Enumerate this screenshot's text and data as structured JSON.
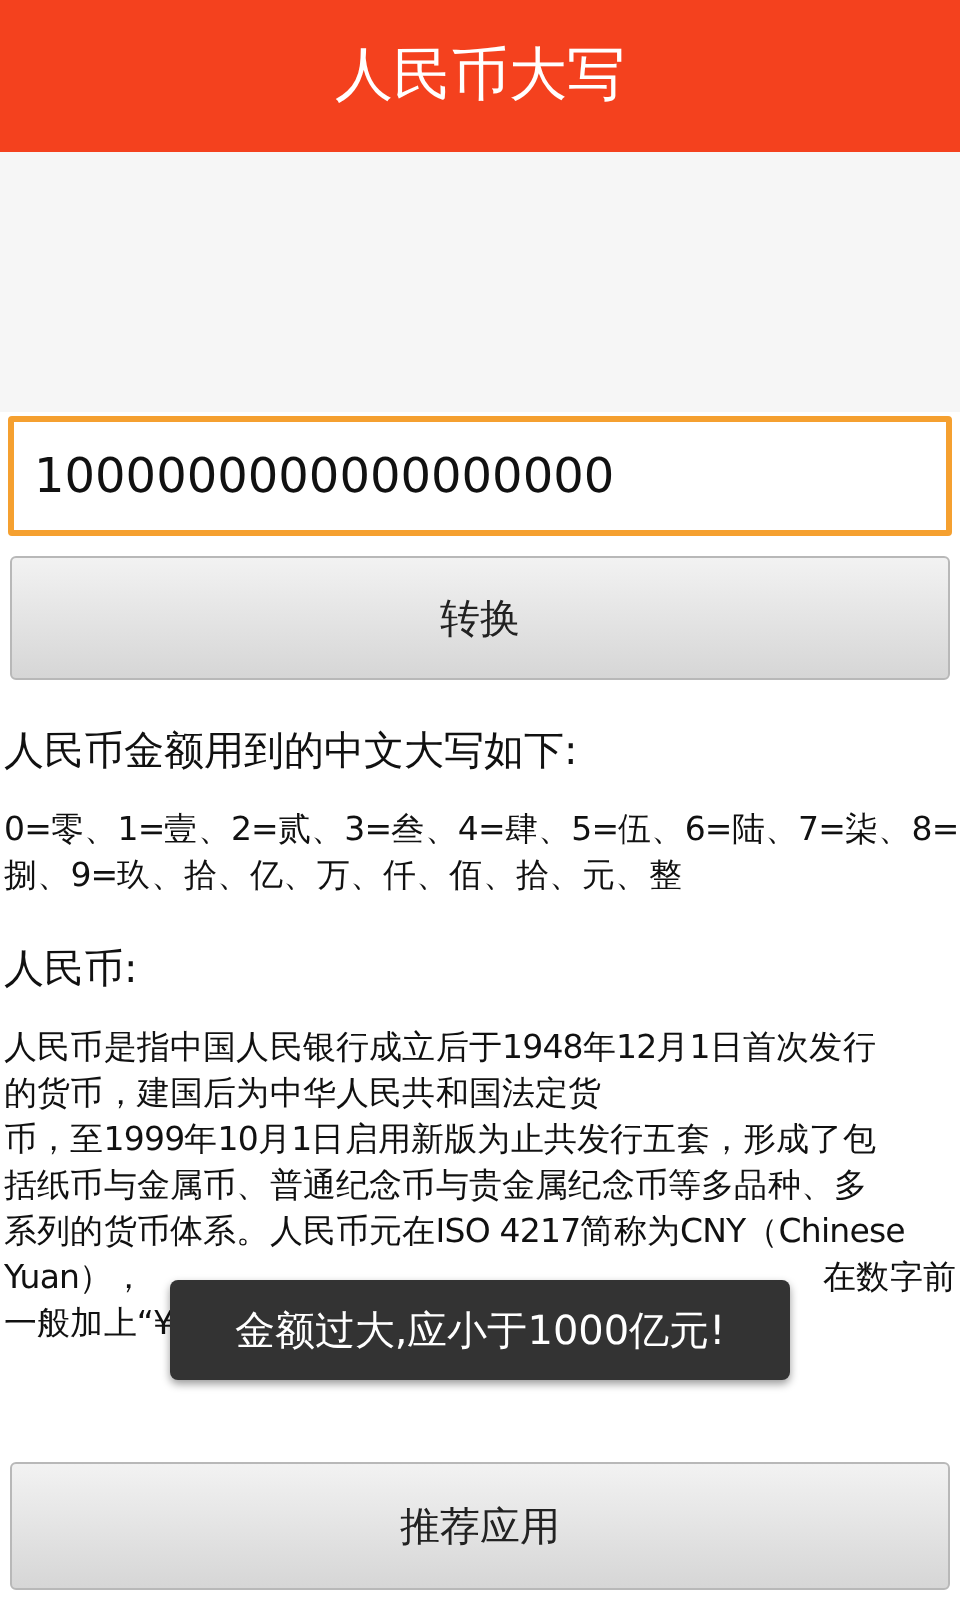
{
  "title_bar": {
    "title": "人民币大写"
  },
  "amount_field": {
    "value": "1000000000000000000",
    "focused": true
  },
  "convert_button": {
    "label": "转换"
  },
  "sections": [
    {
      "heading": "人民币金额用到的中文大写如下:",
      "lines": [
        [
          "0=零、1=壹、2=贰、3=叁、4=肆、5=伍、6=陆、7=柒、8="
        ],
        [
          "捌、9=玖、拾、亿、万、仟、佰、拾、元、整"
        ]
      ]
    },
    {
      "heading": "人民币:",
      "lines": [
        [
          "人民币是指中国人民银行成立后于1948年12月1日首次发行"
        ],
        [
          "的货币，建国后为中华人民共和国法定货"
        ],
        [
          "币，至1999年10月1日启用新版为止共发行五套，形成了包"
        ],
        [
          "括纸币与金属币、普通纪念币与贵金属纪念币等多品种、多"
        ],
        [
          "系列的货币体系。人民币元在ISO 4217简称为CNY（Chinese"
        ],
        [
          "Yuan），",
          "在数字前"
        ],
        [
          "一般加上“¥"
        ]
      ]
    }
  ],
  "toast": {
    "message": "金额过大,应小于1000亿元!"
  },
  "recommend_button": {
    "label": "推荐应用"
  }
}
